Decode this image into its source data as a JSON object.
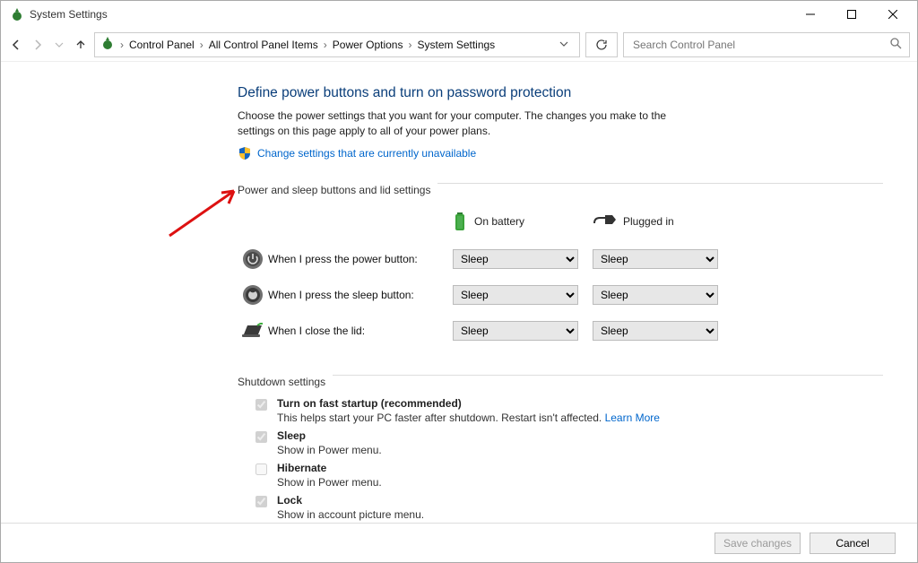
{
  "window": {
    "title": "System Settings"
  },
  "nav": {
    "crumbs": [
      "Control Panel",
      "All Control Panel Items",
      "Power Options",
      "System Settings"
    ],
    "search_placeholder": "Search Control Panel"
  },
  "page": {
    "heading": "Define power buttons and turn on password protection",
    "blurb": "Choose the power settings that you want for your computer. The changes you make to the settings on this page apply to all of your power plans.",
    "change_link": "Change settings that are currently unavailable",
    "group1": "Power and sleep buttons and lid settings",
    "group2": "Shutdown settings",
    "col_battery": "On battery",
    "col_plugged": "Plugged in",
    "rows": [
      {
        "label": "When I press the power button:",
        "battery": "Sleep",
        "plugged": "Sleep"
      },
      {
        "label": "When I press the sleep button:",
        "battery": "Sleep",
        "plugged": "Sleep"
      },
      {
        "label": "When I close the lid:",
        "battery": "Sleep",
        "plugged": "Sleep"
      }
    ],
    "shutdown": [
      {
        "title": "Turn on fast startup (recommended)",
        "desc": "This helps start your PC faster after shutdown. Restart isn't affected. ",
        "link": "Learn More",
        "checked": true
      },
      {
        "title": "Sleep",
        "desc": "Show in Power menu.",
        "checked": true
      },
      {
        "title": "Hibernate",
        "desc": "Show in Power menu.",
        "checked": false
      },
      {
        "title": "Lock",
        "desc": "Show in account picture menu.",
        "checked": true
      }
    ]
  },
  "footer": {
    "save": "Save changes",
    "cancel": "Cancel"
  }
}
